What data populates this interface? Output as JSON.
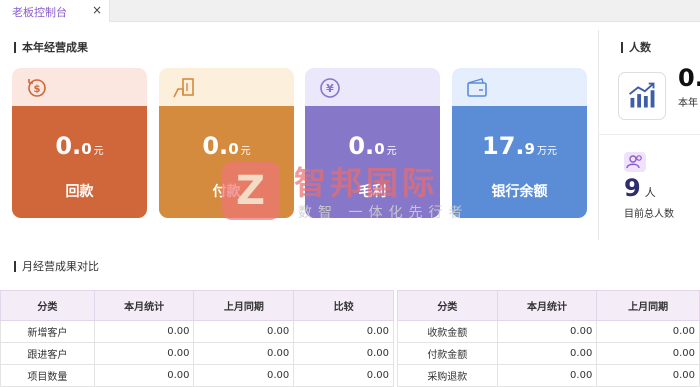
{
  "tab": {
    "label": "老板控制台",
    "close": "×"
  },
  "section_annual": "本年经营成果",
  "section_people": "人数",
  "section_monthly": "月经营成果对比",
  "cards": [
    {
      "int": "0.",
      "frac": "0",
      "unit": "元",
      "name": "回款",
      "icon": "dollar-cycle-icon",
      "color": "#d0673b",
      "top_color": "#fbe7df"
    },
    {
      "int": "0.",
      "frac": "0",
      "unit": "元",
      "name": "付款",
      "icon": "payment-hand-icon",
      "color": "#d48b3d",
      "top_color": "#fcefdc"
    },
    {
      "int": "0.",
      "frac": "0",
      "unit": "元",
      "name": "毛利",
      "icon": "yen-icon",
      "color": "#8777c9",
      "top_color": "#ece8fb"
    },
    {
      "int": "17.",
      "frac": "9",
      "unit": "万元",
      "name": "银行余额",
      "icon": "wallet-icon",
      "color": "#5b8cd6",
      "top_color": "#e4eefc"
    }
  ],
  "stats": {
    "big": "0.",
    "small": "本年",
    "icon": "trend-chart-icon"
  },
  "people": {
    "count": "9",
    "unit": "人",
    "label": "目前总人数",
    "icon": "people-icon"
  },
  "table_left": {
    "headers": [
      "分类",
      "本月统计",
      "上月同期",
      "比较"
    ],
    "rows": [
      [
        "新增客户",
        "0.00",
        "0.00",
        "0.00"
      ],
      [
        "跟进客户",
        "0.00",
        "0.00",
        "0.00"
      ],
      [
        "项目数量",
        "0.00",
        "0.00",
        "0.00"
      ]
    ]
  },
  "table_right": {
    "headers": [
      "分类",
      "本月统计",
      "上月同期"
    ],
    "rows": [
      [
        "收款金额",
        "0.00",
        "0.00"
      ],
      [
        "付款金额",
        "0.00",
        "0.00"
      ],
      [
        "采购退款",
        "0.00",
        "0.00"
      ]
    ]
  },
  "watermark": {
    "letter": "Z",
    "title": "智邦国际",
    "subtitle": "数智 一体化先行者"
  }
}
